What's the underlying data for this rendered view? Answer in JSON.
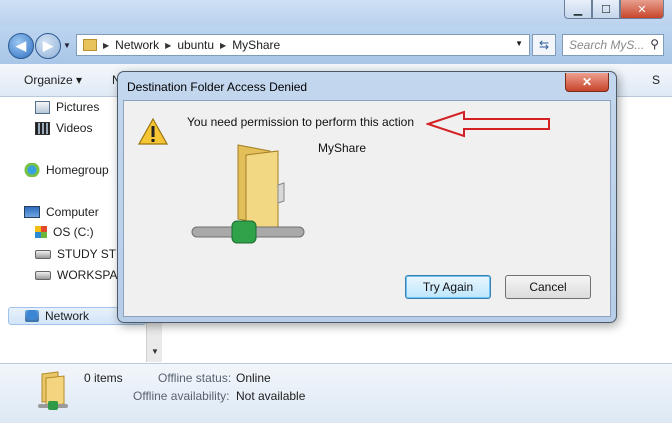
{
  "window": {
    "title_buttons": {
      "minimize": "▁",
      "maximize": "☐",
      "close": "✕"
    }
  },
  "navigation": {
    "back_icon": "arrow-left-icon",
    "forward_icon": "arrow-right-icon",
    "address_segments": [
      "Network",
      "ubuntu",
      "MyShare"
    ],
    "search_placeholder": "Search MyS..."
  },
  "toolbar": {
    "organize_label": "Organize ▾",
    "truncated_button": "N",
    "right_truncated": "S"
  },
  "sidebar": {
    "items": [
      {
        "label": "Pictures",
        "icon": "pictures-icon"
      },
      {
        "label": "Videos",
        "icon": "videos-icon"
      },
      {
        "label": "Homegroup",
        "icon": "homegroup-icon"
      },
      {
        "label": "Computer",
        "icon": "computer-icon"
      },
      {
        "label": "OS (C:)",
        "icon": "windows-drive-icon"
      },
      {
        "label": "STUDY STU",
        "icon": "drive-icon"
      },
      {
        "label": "WORKSPAC",
        "icon": "drive-icon"
      },
      {
        "label": "Network",
        "icon": "network-icon",
        "selected": true
      }
    ]
  },
  "details_pane": {
    "count": "0 items",
    "offline_status_label": "Offline status:",
    "offline_status_value": "Online",
    "offline_availability_label": "Offline availability:",
    "offline_availability_value": "Not available"
  },
  "dialog": {
    "title": "Destination Folder Access Denied",
    "message": "You need permission to perform this action",
    "item_name": "MyShare",
    "try_again_label": "Try Again",
    "cancel_label": "Cancel",
    "close_glyph": "✕"
  },
  "colors": {
    "annotation_arrow": "#d42020",
    "titlebar": "#bad2ee",
    "dialog_frame": "#b7cde8"
  }
}
